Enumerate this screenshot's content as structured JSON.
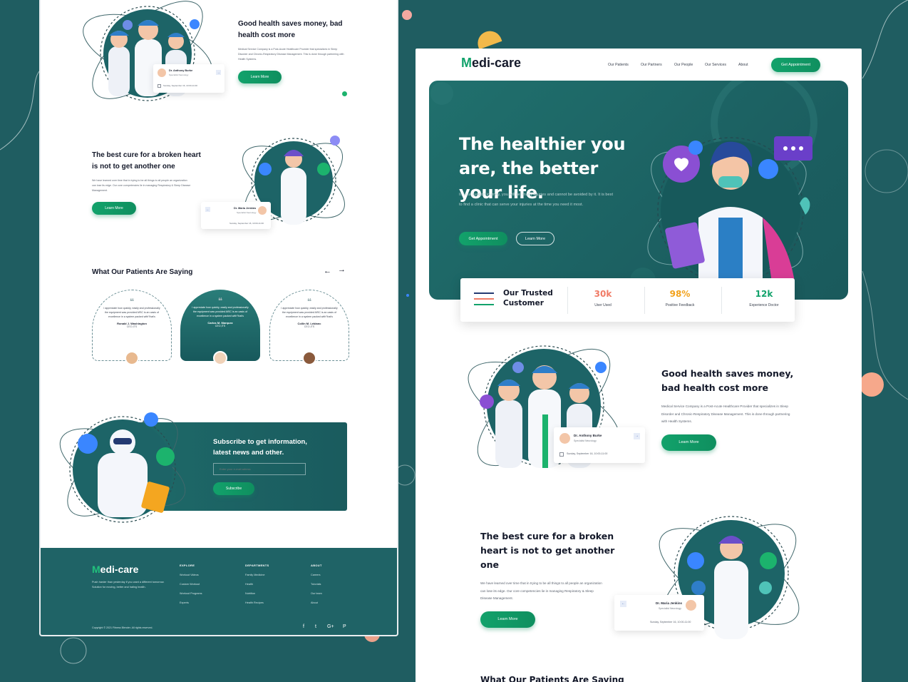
{
  "left": {
    "section1": {
      "title": "Good health saves money, bad health cost more",
      "desc": "Medical Service Company is a Post-Acute Healthcare Provider that specializes in Sleep Disorder and Chronic-Respiratory Disease Management. This is done through partnering with Health Systems.",
      "button": "Learn More",
      "card_name": "Dr. Anthony Burke",
      "card_role": "Specialist Neurology",
      "card_date": "Sunday, September 16, 10:00-11:00"
    },
    "section2": {
      "title": "The best cure for a broken heart is not to get another one",
      "desc": "We have learned over time that in trying to be all things to all people an organization can lose its edge. Our core competencies lie in managing Respiratory & Sleep Disease Management.",
      "button": "Learn More",
      "card_name": "Dr. Maria Jenkins",
      "card_role": "Specialist Neurology",
      "card_date": "Sunday, September 16, 10:00-11:00"
    },
    "testimonials": {
      "title": "What Our Patients Are Saying",
      "items": [
        {
          "quote": "I appreciate how quickly, easily and professionally the equipment was provided.MSC is an oasis of excellence in a system packed with\"that's",
          "name": "Ronald J. Washington",
          "role": "CEO,ITS"
        },
        {
          "quote": "I appreciate how quickly, easily and professionally the equipment was provided.MSC is an oasis of excellence in a system packed with\"that's",
          "name": "Carlos M. Marquez",
          "role": "CEO,ITS"
        },
        {
          "quote": "I appreciate how quickly, easily and professionally the equipment was provided.MSC is an oasis of excellence in a system packed with\"that's",
          "name": "Collin M. Leblanc",
          "role": "CEO,ITS"
        }
      ]
    },
    "subscribe": {
      "title": "Subscribe to get information, latest news and other.",
      "placeholder": "Enter your e-mail adress",
      "button": "Subscribe"
    },
    "footer": {
      "logo_m": "M",
      "logo_rest": "edi-care",
      "blurb": "Push harder than yesterday if you want a different tomorrow. Solution for moving, better and hating health.",
      "cols": [
        {
          "head": "EXPLORE",
          "items": [
            "Workout Videos",
            "Custom Workout",
            "Workout Programs",
            "Experts"
          ]
        },
        {
          "head": "DEPARTMENTS",
          "items": [
            "Family Medicine",
            "Health",
            "Nutrition",
            "Health Recipes"
          ]
        },
        {
          "head": "ABOUT",
          "items": [
            "Careers",
            "Tutorials",
            "Our team",
            "About"
          ]
        }
      ],
      "copyright": "Copyright © 2021 Fitness Blender. All rights reserved.",
      "social": [
        "f",
        "t",
        "G+",
        "P"
      ]
    }
  },
  "right": {
    "nav": {
      "logo_m": "M",
      "logo_rest": "edi-care",
      "items": [
        "Our Patients",
        "Our Partners",
        "Our People",
        "Our Services",
        "About"
      ],
      "button": "Get Appointment"
    },
    "hero": {
      "title": "The healthier you are, the better your life.",
      "desc": "In your support journey, you will get many injuries and cannot be avoided by it. It is best to find a clinic that can serve your injuries at the time you need it most.",
      "btn_primary": "Get Appointment",
      "btn_secondary": "Learn More"
    },
    "stats": {
      "label": "Our Trusted Customer",
      "items": [
        {
          "value": "30k",
          "key": "User Used",
          "color": "#f07b66"
        },
        {
          "value": "98%",
          "key": "Positive Feedback",
          "color": "#f2a21c"
        },
        {
          "value": "12k",
          "key": "Experience Doctor",
          "color": "#12a26b"
        }
      ]
    },
    "section1": {
      "title": "Good health saves money, bad health cost more",
      "desc": "Medical Service Company is a Post-Acute Healthcare Provider that specializes in Sleep Disorder and Chronic-Respiratory Disease Management. This is done through partnering with Health Systems.",
      "button": "Learn More",
      "card_name": "Dr. Anthony Burke",
      "card_role": "Specialist Neurology",
      "card_date": "Sunday, September 16, 10:00-11:00"
    },
    "section2": {
      "title": "The best cure for a broken heart is not to get another one",
      "desc": "We have learned over time that in trying to be all things to all people an organization can lose its edge. Our core competencies lie in managing Respiratory & Sleep Disease Management.",
      "button": "Learn More",
      "card_name": "Dr. Maria Jenkins",
      "card_role": "Specialist Neurology",
      "card_date": "Sunday, September 16, 10:00-11:00"
    },
    "testimonials_title": "What Our Patients Are Saying"
  },
  "colors": {
    "background": "#1f5d61",
    "accent_green": "#12a26b",
    "hero_teal": "#1b5e60",
    "stat_orange": "#f07b66",
    "stat_yellow": "#f2a21c"
  }
}
